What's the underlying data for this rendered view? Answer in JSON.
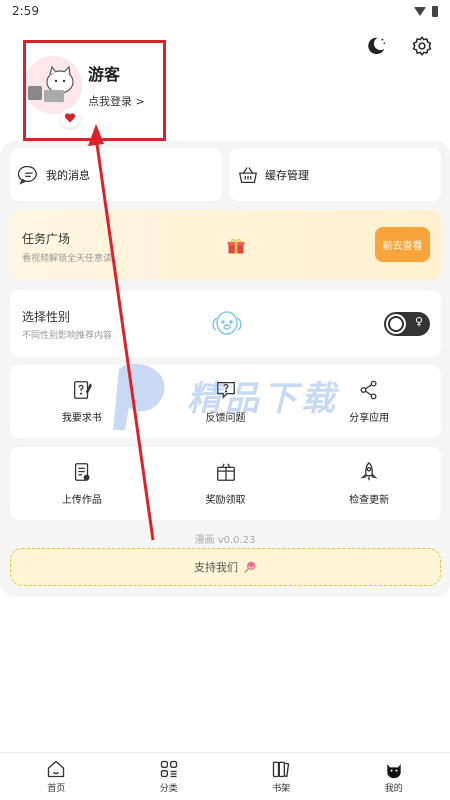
{
  "status": {
    "time": "2:59"
  },
  "profile": {
    "name": "游客",
    "login": "点我登录 >"
  },
  "quick": {
    "messages": "我的消息",
    "cache": "缓存管理"
  },
  "task": {
    "title": "任务广场",
    "subtitle": "看视频解锁全天任意读",
    "button": "前去查看"
  },
  "gender": {
    "title": "选择性别",
    "subtitle": "不同性别影响推荐内容",
    "toggle_label": "♀"
  },
  "grid1": [
    "我要求书",
    "反馈问题",
    "分享应用"
  ],
  "grid2": [
    "上传作品",
    "奖励领取",
    "检查更新"
  ],
  "version": "漫画 v0.0.23",
  "support": "支持我们",
  "nav": [
    "首页",
    "分类",
    "书架",
    "我的"
  ],
  "colors": {
    "accent": "#f7a43a",
    "highlight": "#d9232a",
    "support_border": "#f0c23a"
  }
}
